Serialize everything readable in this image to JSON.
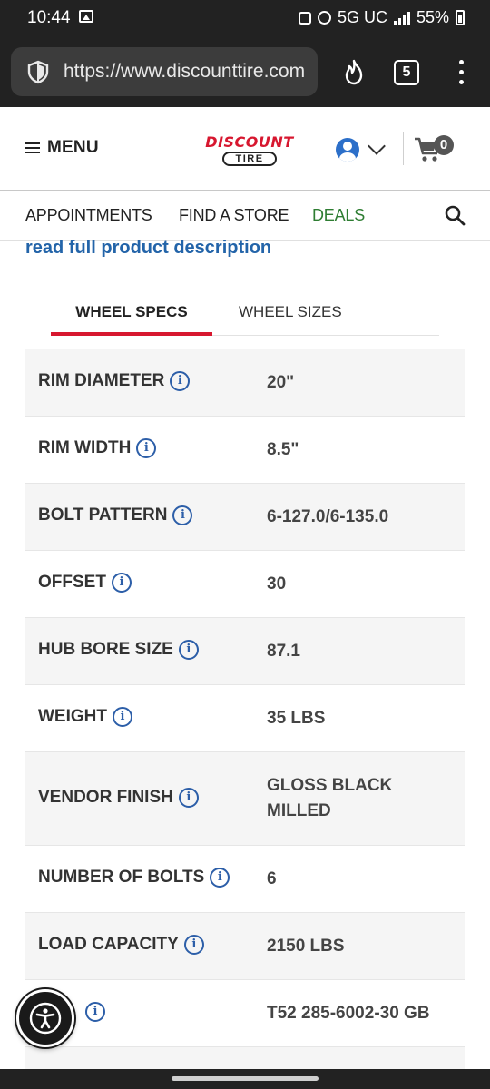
{
  "status_bar": {
    "time": "10:44",
    "network": "5G UC",
    "battery": "55%"
  },
  "browser": {
    "url": "https://www.discounttire.com",
    "tab_count": "5"
  },
  "header": {
    "menu_label": "MENU",
    "logo_top": "DISCOUNT",
    "logo_bottom": "TIRE",
    "cart_count": "0"
  },
  "nav": {
    "items": [
      "APPOINTMENTS",
      "FIND A STORE",
      "DEALS"
    ]
  },
  "content": {
    "read_more": "read full product description",
    "tabs": [
      "WHEEL SPECS",
      "WHEEL SIZES"
    ],
    "specs": [
      {
        "label": "RIM DIAMETER",
        "value": "20\""
      },
      {
        "label": "RIM WIDTH",
        "value": "8.5\""
      },
      {
        "label": "BOLT PATTERN",
        "value": "6-127.0/6-135.0"
      },
      {
        "label": "OFFSET",
        "value": "30"
      },
      {
        "label": "HUB BORE SIZE",
        "value": "87.1"
      },
      {
        "label": "WEIGHT",
        "value": "35 LBS"
      },
      {
        "label": "VENDOR FINISH",
        "value": "GLOSS BLACK MILLED"
      },
      {
        "label": "NUMBER OF BOLTS",
        "value": "6"
      },
      {
        "label": "LOAD CAPACITY",
        "value": "2150 LBS"
      },
      {
        "label": "",
        "value": "T52 285-6002-30 GB"
      }
    ]
  },
  "colors": {
    "brand_red": "#d7172f",
    "link_blue": "#2364a9",
    "deals_green": "#2e7d32"
  }
}
